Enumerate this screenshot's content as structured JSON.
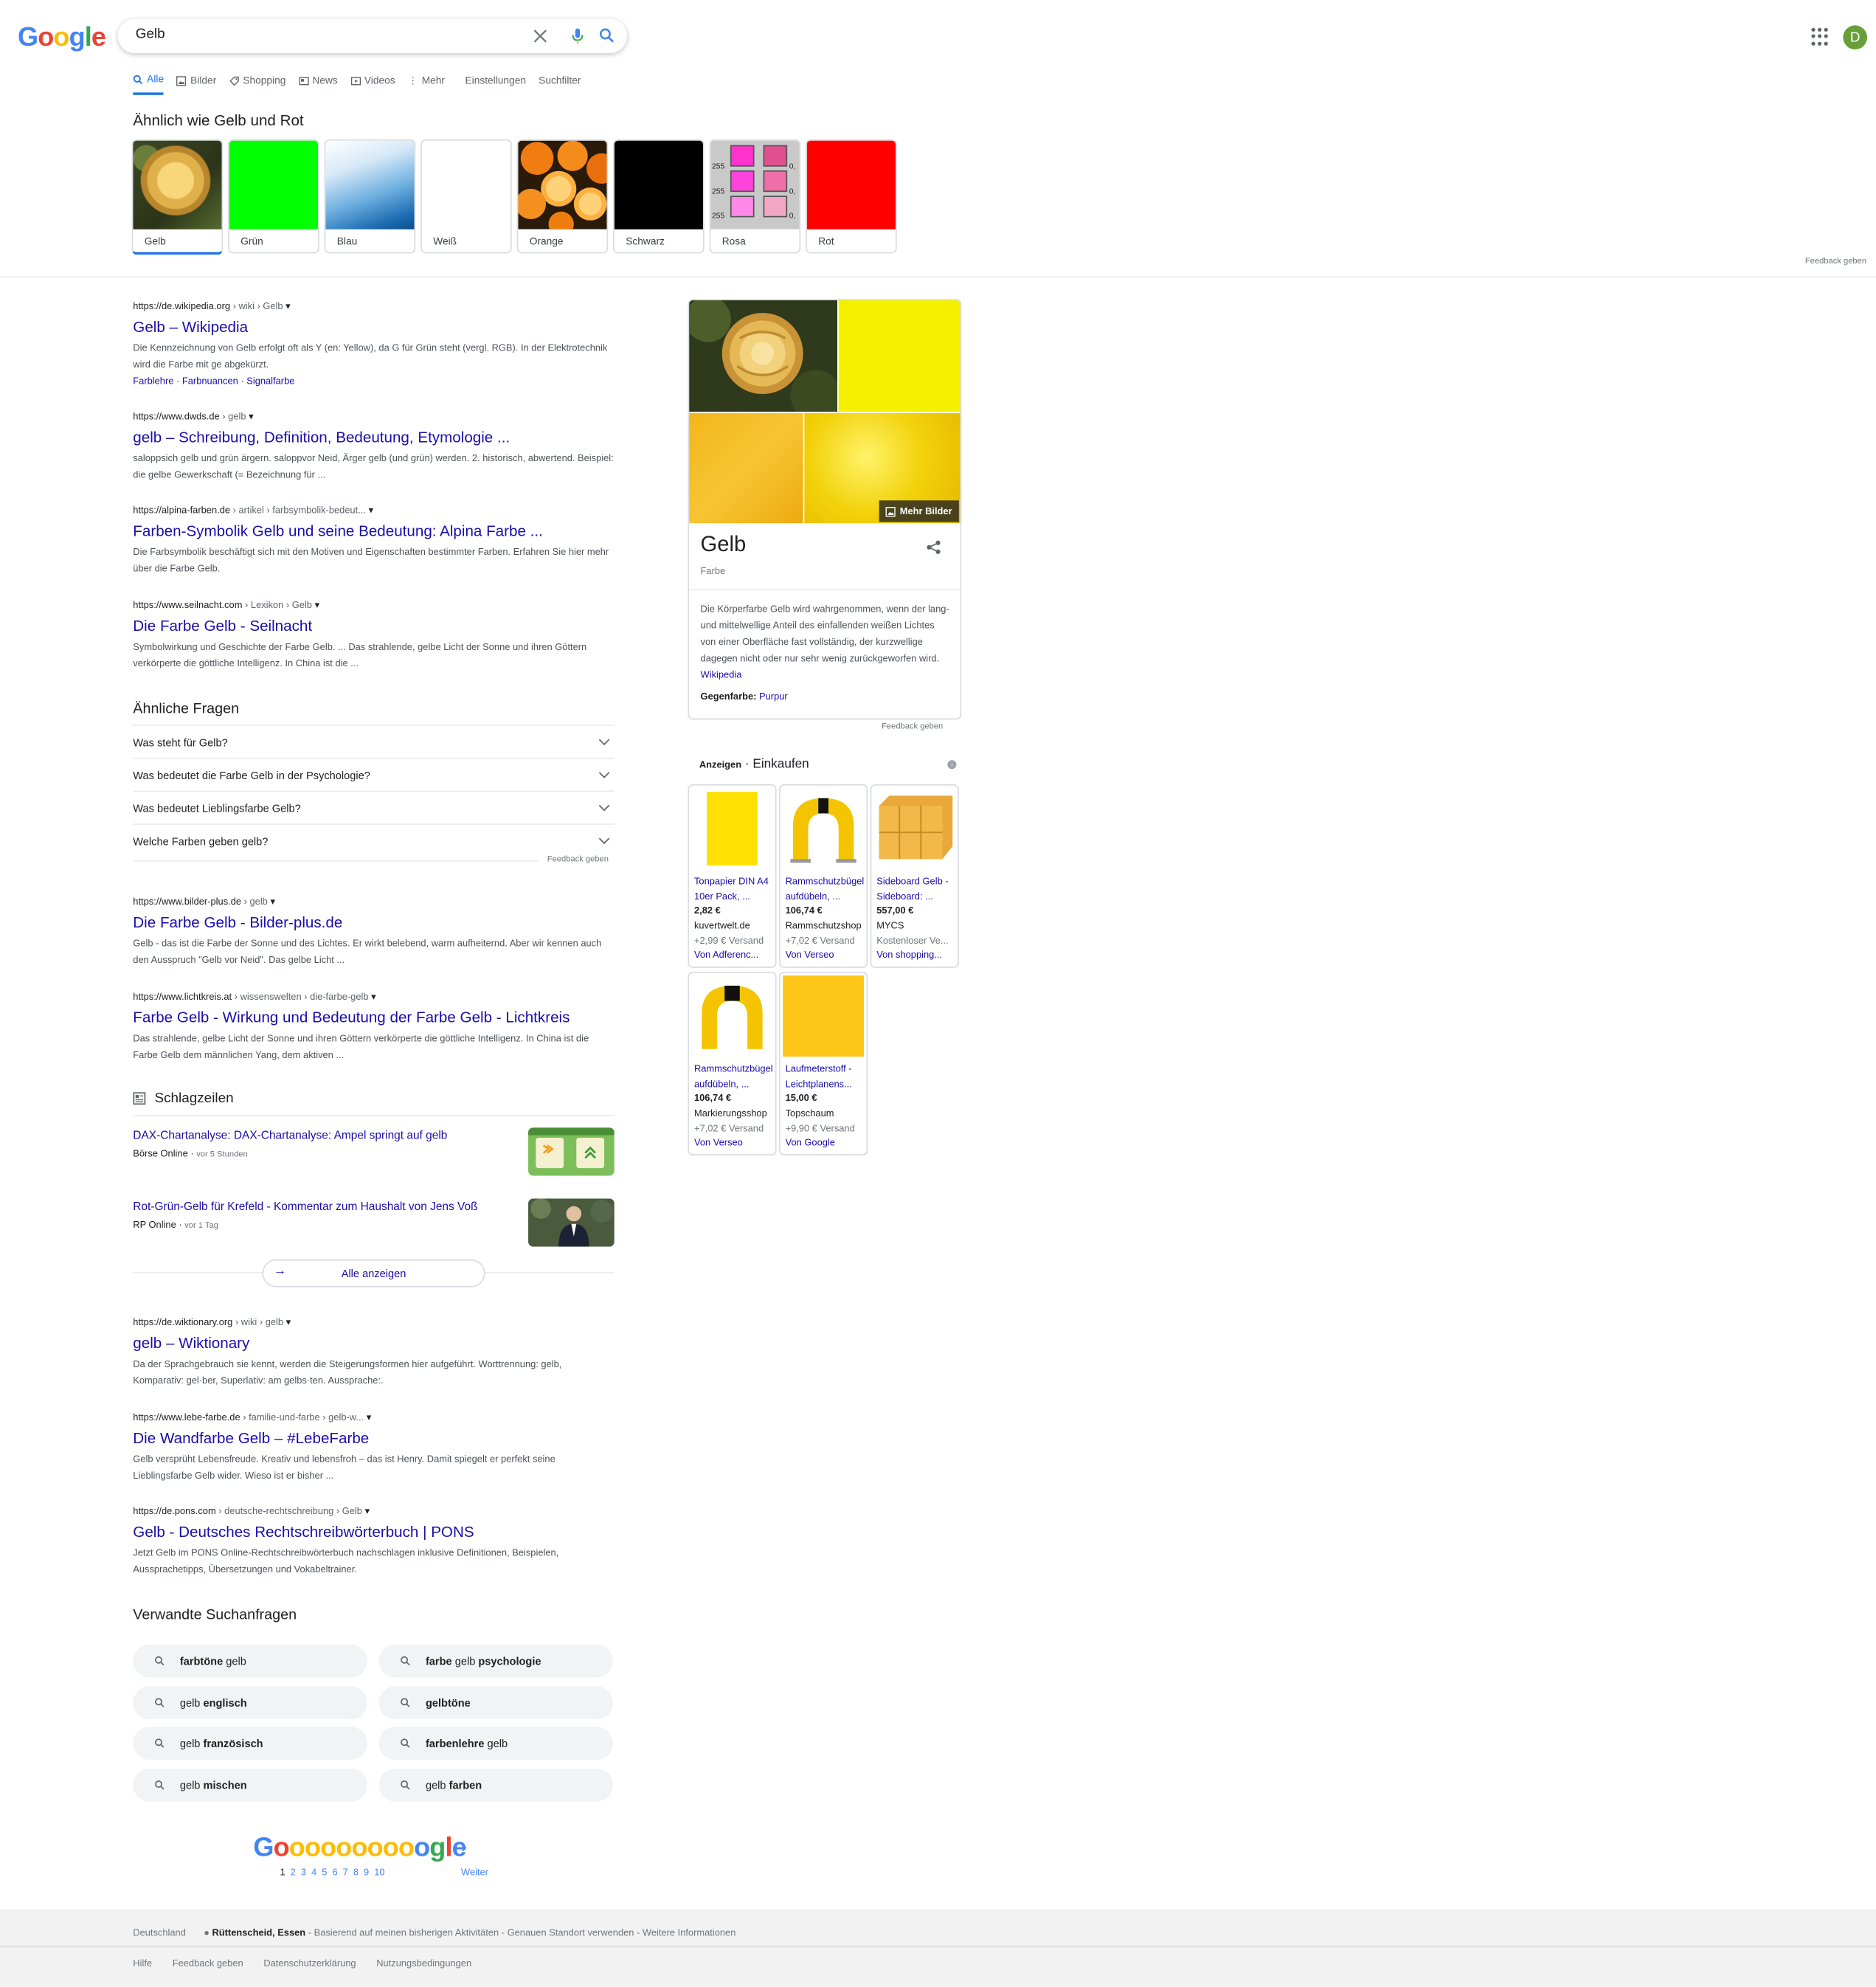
{
  "header": {
    "search_value": "Gelb",
    "avatar_letter": "D",
    "logo_letters": [
      "G",
      "o",
      "o",
      "g",
      "l",
      "e"
    ]
  },
  "tabs": [
    "Alle",
    "Bilder",
    "Shopping",
    "News",
    "Videos",
    "Mehr",
    "Einstellungen",
    "Suchfilter"
  ],
  "similar": {
    "title": "Ähnlich wie Gelb und Rot",
    "chips": [
      "Gelb",
      "Grün",
      "Blau",
      "Weiß",
      "Orange",
      "Schwarz",
      "Rosa",
      "Rot"
    ],
    "rosa_numbers": [
      "255",
      "255",
      "255",
      "0,",
      "0,",
      "0,"
    ],
    "feedback": "Feedback geben"
  },
  "results": [
    {
      "domain": "https://de.wikipedia.org",
      "path": " › wiki › Gelb",
      "title": "Gelb – Wikipedia",
      "snippet": "Die Kennzeichnung von Gelb erfolgt oft als Y (en: Yellow), da G für Grün steht (vergl. RGB). In der Elektrotechnik wird die Farbe mit ge abgekürzt.",
      "sublinks": [
        "Farblehre",
        "Farbnuancen",
        "Signalfarbe"
      ]
    },
    {
      "domain": "https://www.dwds.de",
      "path": " › gelb",
      "title": "gelb – Schreibung, Definition, Bedeutung, Etymologie ...",
      "snippet": "saloppsich gelb und grün ärgern. saloppvor Neid, Ärger gelb (und grün) werden. 2. historisch, abwertend. Beispiel: die gelbe Gewerkschaft (= Bezeichnung für ..."
    },
    {
      "domain": "https://alpina-farben.de",
      "path": " › artikel › farbsymbolik-bedeut...",
      "title": "Farben-Symbolik Gelb und seine Bedeutung: Alpina Farbe ...",
      "snippet": "Die Farbsymbolik beschäftigt sich mit den Motiven und Eigenschaften bestimmter Farben. Erfahren Sie hier mehr über die Farbe Gelb."
    },
    {
      "domain": "https://www.seilnacht.com",
      "path": " › Lexikon › Gelb",
      "title": "Die Farbe Gelb - Seilnacht",
      "snippet": "Symbolwirkung und Geschichte der Farbe Gelb. ... Das strahlende, gelbe Licht der Sonne und ihren Göttern verkörperte die göttliche Intelligenz. In China ist die ..."
    },
    {
      "domain": "https://www.bilder-plus.de",
      "path": " › gelb",
      "title": "Die Farbe Gelb - Bilder-plus.de",
      "snippet": "Gelb - das ist die Farbe der Sonne und des Lichtes. Er wirkt belebend, warm aufheiternd. Aber wir kennen auch den Ausspruch \"Gelb vor Neid\". Das gelbe Licht ..."
    },
    {
      "domain": "https://www.lichtkreis.at",
      "path": " › wissenswelten › die-farbe-gelb",
      "title": "Farbe Gelb - Wirkung und Bedeutung der Farbe Gelb - Lichtkreis",
      "snippet": "Das strahlende, gelbe Licht der Sonne und ihren Göttern verkörperte die göttliche Intelligenz. In China ist die Farbe Gelb dem männlichen Yang, dem aktiven ..."
    },
    {
      "domain": "https://de.wiktionary.org",
      "path": " › wiki › gelb",
      "title": "gelb – Wiktionary",
      "snippet": "Da der Sprachgebrauch sie kennt, werden die Steigerungsformen hier aufgeführt. Worttrennung: gelb, Komparativ: gel·ber, Superlativ: am gelbs·ten. Aussprache:."
    },
    {
      "domain": "https://www.lebe-farbe.de",
      "path": " › familie-und-farbe › gelb-w...",
      "title": "Die Wandfarbe Gelb – #LebeFarbe",
      "snippet": "Gelb versprüht Lebensfreude. Kreativ und lebensfroh – das ist Henry. Damit spiegelt er perfekt seine Lieblingsfarbe Gelb wider. Wieso ist er bisher ..."
    },
    {
      "domain": "https://de.pons.com",
      "path": " › deutsche-rechtschreibung › Gelb",
      "title": "Gelb - Deutsches Rechtschreibwörterbuch | PONS",
      "snippet": "Jetzt Gelb im PONS Online-Rechtschreibwörterbuch nachschlagen inklusive Definitionen, Beispielen, Aussprachetipps, Übersetzungen und Vokabeltrainer."
    }
  ],
  "paa": {
    "title": "Ähnliche Fragen",
    "questions": [
      "Was steht für Gelb?",
      "Was bedeutet die Farbe Gelb in der Psychologie?",
      "Was bedeutet Lieblingsfarbe Gelb?",
      "Welche Farben geben gelb?"
    ],
    "feedback": "Feedback geben"
  },
  "news": {
    "title": "Schlagzeilen",
    "items": [
      {
        "title": "DAX-Chartanalyse: DAX-Chartanalyse: Ampel springt auf gelb",
        "source": "Börse Online",
        "time": "vor 5 Stunden"
      },
      {
        "title": "Rot-Grün-Gelb für Krefeld - Kommentar zum Haushalt von Jens Voß",
        "source": "RP Online",
        "time": "vor 1 Tag"
      }
    ],
    "all_label": "Alle anzeigen"
  },
  "related": {
    "title": "Verwandte Suchanfragen",
    "items": [
      {
        "pre": "",
        "bold": "farbtöne",
        "post": " gelb"
      },
      {
        "pre": "",
        "bold": "farbe",
        "post": " gelb ",
        "bold2": "psychologie"
      },
      {
        "pre": "gelb ",
        "bold": "englisch",
        "post": ""
      },
      {
        "pre": "",
        "bold": "gelbtöne",
        "post": ""
      },
      {
        "pre": "gelb ",
        "bold": "französisch",
        "post": ""
      },
      {
        "pre": "",
        "bold": "farbenlehre",
        "post": " gelb"
      },
      {
        "pre": "gelb ",
        "bold": "mischen",
        "post": ""
      },
      {
        "pre": "gelb ",
        "bold": "farben",
        "post": ""
      }
    ]
  },
  "pagination": {
    "logo_text": "Goooooooooogle",
    "pages": [
      "1",
      "2",
      "3",
      "4",
      "5",
      "6",
      "7",
      "8",
      "9",
      "10"
    ],
    "current": "1",
    "next_label": "Weiter"
  },
  "knowledge_panel": {
    "title": "Gelb",
    "subtitle": "Farbe",
    "more_images": "Mehr Bilder",
    "description": "Die Körperfarbe Gelb wird wahrgenommen, wenn der lang- und mittelwellige Anteil des einfallenden weißen Lichtes von einer Oberfläche fast vollständig, der kurzwellige dagegen nicht oder nur sehr wenig zurückgeworfen wird.",
    "source": "Wikipedia",
    "opposite_label": "Gegenfarbe:",
    "opposite_value": "Purpur",
    "feedback": "Feedback geben"
  },
  "ads": {
    "label": "Anzeigen",
    "title": "Einkaufen",
    "info": "i",
    "products": [
      {
        "title": "Tonpapier DIN A4 10er Pack, ...",
        "price": "2,82 €",
        "merchant": "kuvertwelt.de",
        "shipping": "+2,99 € Versand",
        "via": "Von Adferenc..."
      },
      {
        "title": "Rammschutzbügel aufdübeln, ...",
        "price": "106,74 €",
        "merchant": "Rammschutzshop",
        "shipping": "+7,02 € Versand",
        "via": "Von Verseo"
      },
      {
        "title": "Sideboard Gelb - Sideboard: ...",
        "price": "557,00 €",
        "merchant": "MYCS",
        "shipping": "Kostenloser Ve...",
        "via": "Von shopping..."
      },
      {
        "title": "Rammschutzbügel aufdübeln, ...",
        "price": "106,74 €",
        "merchant": "Markierungsshop",
        "shipping": "+7,02 € Versand",
        "via": "Von Verseo"
      },
      {
        "title": "Laufmeterstoff - Leichtplanens...",
        "price": "15,00 €",
        "merchant": "Topschaum",
        "shipping": "+9,90 € Versand",
        "via": "Von Google"
      }
    ]
  },
  "footer": {
    "country": "Deutschland",
    "location": "Rüttenscheid, Essen",
    "location_info": " - Basierend auf meinen bisherigen Aktivitäten - Genauen Standort verwenden - Weitere Informationen",
    "links": [
      "Hilfe",
      "Feedback geben",
      "Datenschutzerklärung",
      "Nutzungsbedingungen"
    ]
  },
  "colors": {
    "link": "#1a0dab",
    "accent": "#1a73e8",
    "yellow": "#f5f000",
    "green": "#00ff00",
    "red": "#ff0000",
    "black": "#000000"
  }
}
